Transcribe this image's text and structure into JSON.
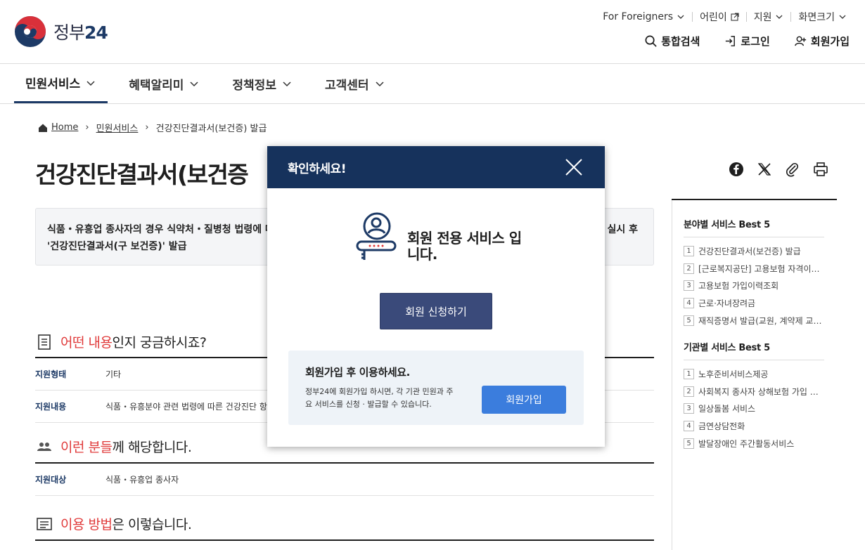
{
  "header": {
    "logo_text": "정부",
    "logo_num": "24",
    "utility": [
      "For Foreigners",
      "어린이",
      "지원",
      "화면크기"
    ],
    "actions": [
      "통합검색",
      "로그인",
      "회원가입"
    ]
  },
  "gnb": [
    "민원서비스",
    "혜택알리미",
    "정책정보",
    "고객센터"
  ],
  "breadcrumb": [
    "Home",
    "민원서비스",
    "건강진단결과서(보건증) 발급"
  ],
  "page_title": "건강진단결과서(보건증",
  "notice": {
    "line1": "식품・유흥업 종사자의 경우 식약처・질병청 법령에 따",
    "line1_end": "실시 후",
    "line2": "'건강진단결과서(구 보건증)' 발급"
  },
  "sections": {
    "s1": {
      "hl": "어떤 내용",
      "rest": "인지 궁금하시죠?"
    },
    "s1_rows": [
      {
        "k": "지원형태",
        "v": "기타"
      },
      {
        "k": "지원내용",
        "v": "식품・유흥분야 관련 법령에 따른 건강진단 항목에"
      }
    ],
    "s2": {
      "hl": "이런 분들",
      "rest": "께 해당합니다."
    },
    "s2_rows": [
      {
        "k": "지원대상",
        "v": "식품・유흥업 종사자"
      }
    ],
    "s3": {
      "hl": "이용 방법",
      "rest": "은 이렇습니다."
    }
  },
  "sidebar": {
    "best_field": {
      "title": "분야별 서비스 Best 5",
      "items": [
        "건강진단결과서(보건증) 발급",
        "[근로복지공단] 고용보험 자격이…",
        "고용보험 가입이력조회",
        "근로·자녀장려금",
        "재직증명서 발급(교원, 계약제 교…"
      ]
    },
    "best_agency": {
      "title": "기관별 서비스 Best 5",
      "items": [
        "노후준비서비스제공",
        "사회복지 종사자 상해보험 가입 …",
        "일상돌봄 서비스",
        "금연상담전화",
        "발달장애인 주간활동서비스"
      ]
    }
  },
  "modal": {
    "title": "확인하세요!",
    "message": "회원 전용 서비스 입니다.",
    "apply_button": "회원 신청하기",
    "box_title": "회원가입 후 이용하세요.",
    "box_desc": "정부24에 회원가입 하시면, 각 기관 민원과 주요 서비스를 신청 · 발급할 수 있습니다.",
    "join_button": "회원가입"
  },
  "colors": {
    "primary": "#16325c",
    "accent_red": "#e03a3a",
    "join_blue": "#3b7ddd"
  }
}
